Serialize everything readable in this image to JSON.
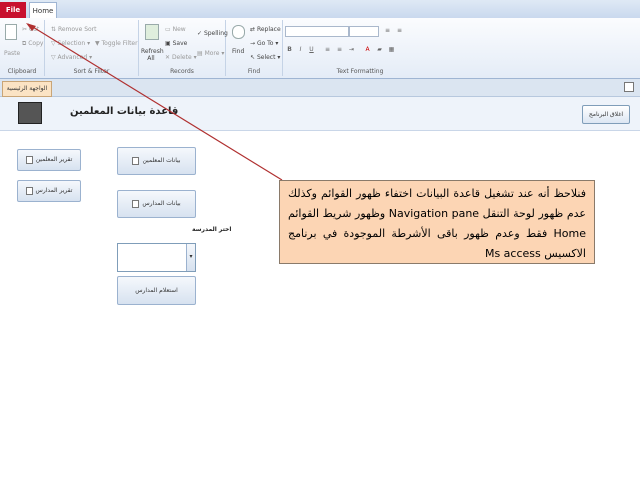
{
  "tabs": {
    "file": "File",
    "home": "Home"
  },
  "ribbon": {
    "clipboard": {
      "paste": "Paste",
      "cut": "Cut",
      "copy": "Copy",
      "label": "Clipboard"
    },
    "sort_filter": {
      "remove_sort": "Remove Sort",
      "selection": "Selection",
      "advanced": "Advanced",
      "toggle_filter": "Toggle Filter",
      "label": "Sort & Filter"
    },
    "records": {
      "refresh_all": "Refresh All",
      "new": "New",
      "save": "Save",
      "delete": "Delete",
      "spelling": "Spelling",
      "more": "More",
      "label": "Records"
    },
    "find": {
      "find": "Find",
      "replace": "Replace",
      "goto": "Go To",
      "select": "Select",
      "label": "Find"
    },
    "text_formatting": {
      "label": "Text Formatting"
    }
  },
  "document_tab": "الواجهة الرئيسية",
  "form": {
    "title": "قاعدة بيانات المعلمين",
    "close_app": "اغلاق البرنامج",
    "buttons": {
      "teachers_data": "بيانات المعلمين",
      "schools_data": "بيانات المدارس",
      "teachers_report": "تقرير المعلمين",
      "schools_report": "تقرير المدارس",
      "school_query": "استعلام المدارس"
    },
    "choose_school_label": "اختر المدرسة",
    "school_combo_value": ""
  },
  "callout": {
    "text": "فنلاحظ أنه عند تشغيل قاعدة البيانات اختفاء ظهور القوائم وكذلك عدم ظهور لوحة التنقل Navigation pane وظهور شريط القوائم Home فقط وعدم ظهور باقى الأشرطة الموجودة في برنامج الاكسيس Ms access"
  }
}
